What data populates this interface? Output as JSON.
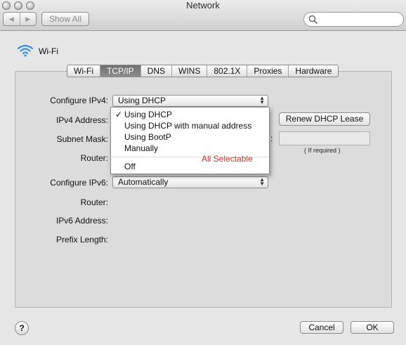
{
  "window": {
    "title": "Network"
  },
  "toolbar": {
    "back_icon": "chevron-left-icon",
    "forward_icon": "chevron-right-icon",
    "back_glyph": "◀",
    "forward_glyph": "▶",
    "show_all_label": "Show All",
    "search_placeholder": "",
    "search_value": ""
  },
  "interface": {
    "name": "Wi-Fi",
    "icon": "wifi-icon"
  },
  "tabs": [
    {
      "label": "Wi-Fi",
      "active": false
    },
    {
      "label": "TCP/IP",
      "active": true
    },
    {
      "label": "DNS",
      "active": false
    },
    {
      "label": "WINS",
      "active": false
    },
    {
      "label": "802.1X",
      "active": false
    },
    {
      "label": "Proxies",
      "active": false
    },
    {
      "label": "Hardware",
      "active": false
    }
  ],
  "ipv4": {
    "configure_label": "Configure IPv4:",
    "configure_value": "Using DHCP",
    "address_label": "IPv4 Address:",
    "subnet_label": "Subnet Mask:",
    "router_label": "Router:",
    "renew_button": "Renew DHCP Lease",
    "client_id_colon": ":",
    "client_id_value": "",
    "client_id_hint": "( If required )"
  },
  "ipv4_menu": {
    "items": [
      {
        "label": "Using DHCP",
        "checked": true,
        "check_glyph": "✓"
      },
      {
        "label": "Using DHCP with manual address",
        "checked": false
      },
      {
        "label": "Using BootP",
        "checked": false
      },
      {
        "label": "Manually",
        "checked": false
      },
      {
        "label": "Off",
        "checked": false
      }
    ],
    "annotation": "All Selectable",
    "annotation_color": "#c0392b"
  },
  "ipv6": {
    "configure_label": "Configure IPv6:",
    "configure_value": "Automatically",
    "router_label": "Router:",
    "address_label": "IPv6 Address:",
    "prefix_label": "Prefix Length:"
  },
  "footer": {
    "help_label": "?",
    "cancel_label": "Cancel",
    "ok_label": "OK"
  }
}
